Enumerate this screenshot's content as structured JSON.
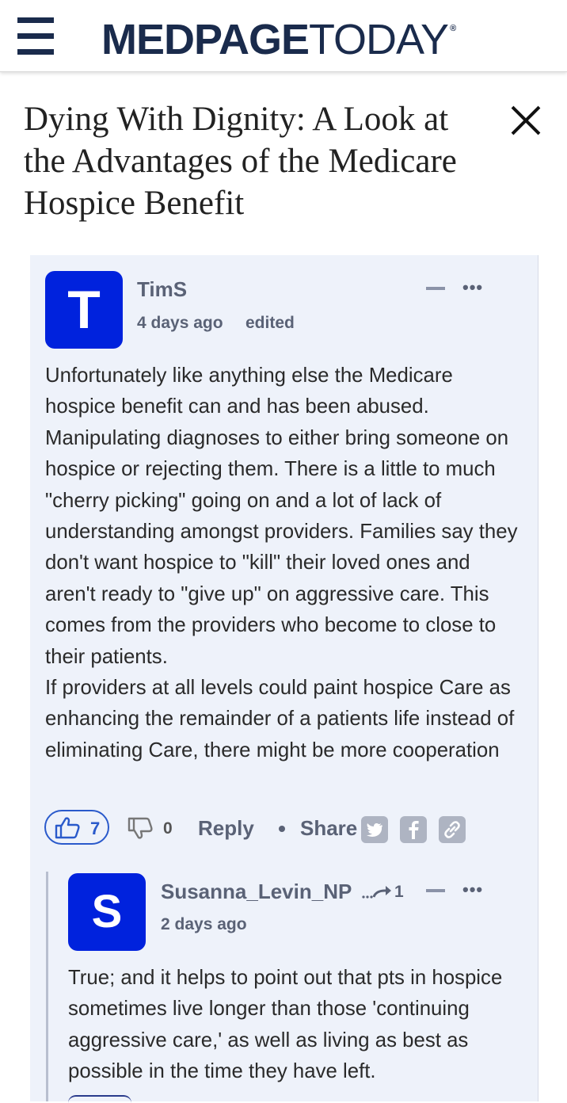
{
  "header": {
    "logo_bold": "MEDPAGE",
    "logo_light": "TODAY",
    "logo_reg": "®"
  },
  "article": {
    "title": "Dying With Dignity: A Look at the Advantages of the Medicare Hospice Benefit"
  },
  "comments": [
    {
      "avatar_letter": "T",
      "author": "TimS",
      "time": "4 days ago",
      "edited": "edited",
      "more": "•••",
      "body": [
        "Unfortunately like anything else the Medicare hospice benefit can and has been abused. Manipulating diagnoses to either bring someone on hospice or rejecting them. There is a little to much \"cherry picking\" going on and a lot of lack of understanding amongst providers. Families say they don't want hospice to \"kill\" their loved ones and aren't ready to \"give up\" on aggressive care. This comes from the providers who become to close to their patients.",
        "If providers at all levels could paint hospice Care as enhancing the remainder of a patients life instead of eliminating Care, there might be more cooperation"
      ],
      "likes": "7",
      "dislikes": "0",
      "reply_label": "Reply",
      "share_label": "Share",
      "share_chevron": "›"
    },
    {
      "avatar_letter": "S",
      "author": "Susanna_Levin_NP",
      "reply_to_count": "1",
      "time": "2 days ago",
      "more": "•••",
      "body": "True; and it helps to point out that pts in hospice sometimes live longer than those 'continuing aggressive care,' as well as living as best as possible in the time they have left."
    }
  ],
  "icons": {
    "menu": "hamburger-icon",
    "close": "close-icon",
    "like": "thumbs-up-icon",
    "dislike": "thumbs-down-icon",
    "twitter": "twitter-icon",
    "facebook": "facebook-icon",
    "link": "link-icon",
    "reply_arrow": "reply-arrow-icon"
  },
  "colors": {
    "brand_navy": "#1a2b4c",
    "avatar_blue": "#0022dd",
    "like_blue": "#2a5acb",
    "panel_bg": "#eef2fa"
  }
}
